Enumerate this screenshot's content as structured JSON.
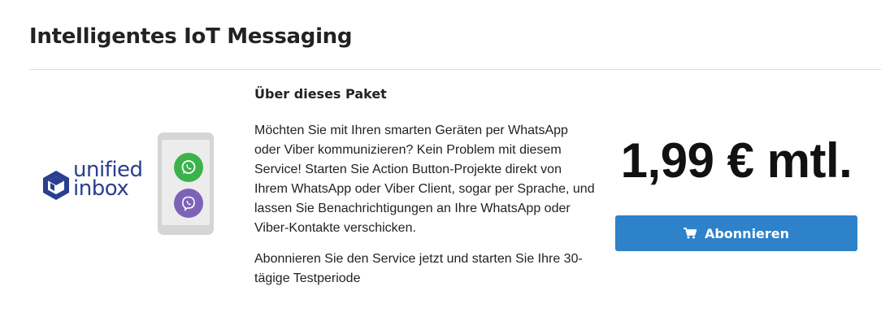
{
  "page": {
    "title": "Intelligentes IoT Messaging"
  },
  "logo": {
    "text_line1": "unified",
    "text_line2": "inbox",
    "brand_color": "#2a3f8f"
  },
  "phone": {
    "apps": [
      {
        "icon": "whatsapp-icon",
        "color": "#3bb34a"
      },
      {
        "icon": "viber-icon",
        "color": "#7d63b8"
      }
    ]
  },
  "package": {
    "heading": "Über dieses Paket",
    "paragraph1": "Möchten Sie mit Ihren smarten Geräten per WhatsApp oder Viber kommunizieren? Kein Problem mit diesem Service! Starten Sie Action Button-Projekte direkt von Ihrem WhatsApp oder Viber Client, sogar per Sprache, und lassen Sie Benachrichtigungen an Ihre WhatsApp oder Viber-Kontakte verschicken.",
    "paragraph2": "Abonnieren Sie den Service jetzt und starten Sie Ihre 30-tägige Testperiode"
  },
  "pricing": {
    "price": "1,99 € mtl.",
    "subscribe_label": "Abonnieren",
    "button_color": "#2d82c9"
  }
}
